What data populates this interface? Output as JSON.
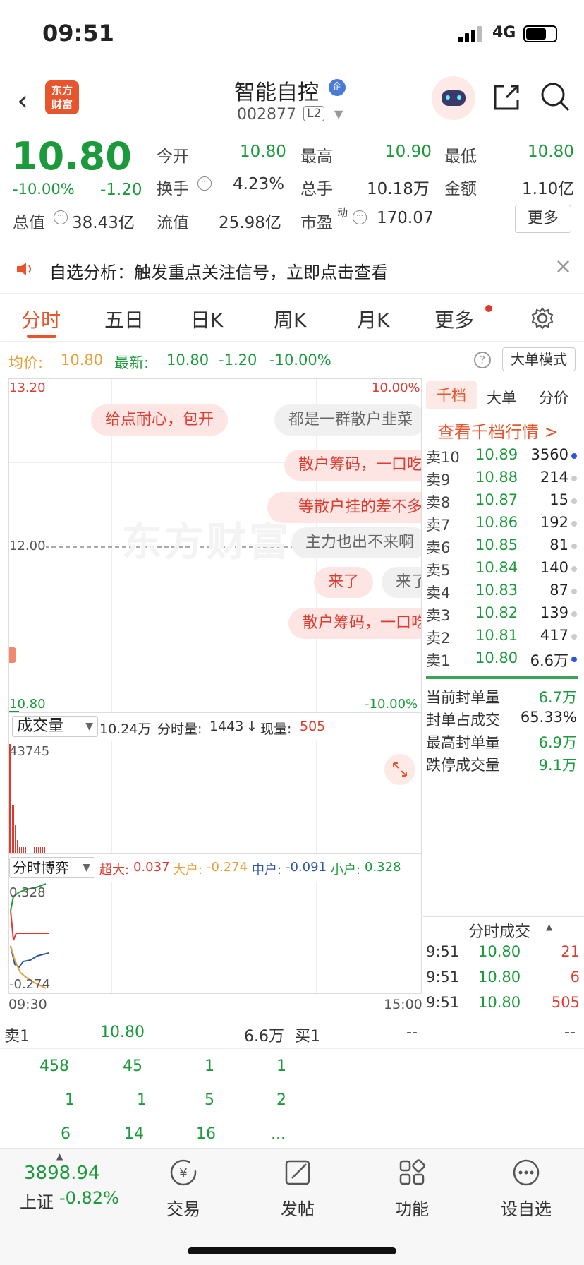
{
  "status": {
    "time": "09:51",
    "network": "4G"
  },
  "header": {
    "logo_text": "东方\n财富",
    "stock_name": "智能自控",
    "badge": "企",
    "code": "002877",
    "level": "L2"
  },
  "quote": {
    "price": "10.80",
    "change_pct": "-10.00%",
    "change": "-1.20",
    "open_label": "今开",
    "open": "10.80",
    "high_label": "最高",
    "high": "10.90",
    "low_label": "最低",
    "low": "10.80",
    "turnover_label": "换手",
    "turnover": "4.23%",
    "volume_label": "总手",
    "volume": "10.18万",
    "amount_label": "金额",
    "amount": "1.10亿",
    "mktcap_label": "总值",
    "mktcap": "38.43亿",
    "float_label": "流值",
    "float": "25.98亿",
    "pe_label": "市盈",
    "pe_sup": "动",
    "pe": "170.07",
    "more_label": "更多"
  },
  "notice": {
    "text": "自选分析：触发重点关注信号，立即点击查看"
  },
  "tabs": [
    "分时",
    "五日",
    "日K",
    "周K",
    "月K",
    "更多"
  ],
  "avg_row": {
    "avg_label": "均价:",
    "avg": "10.80",
    "latest_label": "最新:",
    "latest": "10.80",
    "chg": "-1.20",
    "pct": "-10.00%",
    "mode_label": "大单模式"
  },
  "chart": {
    "y_top": "13.20",
    "pct_top": "10.00%",
    "y_mid": "12.00",
    "y_bottom": "10.80",
    "pct_bottom": "-10.00%",
    "watermark": "东方财富",
    "bubbles": [
      "给点耐心，包开",
      "都是一群散户韭菜",
      "散户筹码，一口吃",
      "等散户挂的差不多",
      "主力也出不来啊",
      "来了",
      "来了",
      "散户筹码，一口吃"
    ]
  },
  "vol": {
    "label": "成交量",
    "total": "10.24万",
    "fs_label": "分时量:",
    "fs": "1443",
    "arrow": "↓",
    "cur_label": "现量:",
    "cur": "505",
    "max": "43745"
  },
  "by": {
    "label": "分时博弈",
    "super_label": "超大:",
    "super": "0.037",
    "big_label": "大户:",
    "big": "-0.274",
    "mid_label": "中户:",
    "mid": "-0.091",
    "small_label": "小户:",
    "small": "0.328",
    "ymax": "0.328",
    "ymin": "-0.274",
    "t_start": "09:30",
    "t_end": "15:00"
  },
  "panel": {
    "tabs": [
      "千档",
      "大单",
      "分价"
    ],
    "link": "查看千档行情 >",
    "asks": [
      {
        "label": "卖10",
        "price": "10.89",
        "vol": "3560"
      },
      {
        "label": "卖9",
        "price": "10.88",
        "vol": "214"
      },
      {
        "label": "卖8",
        "price": "10.87",
        "vol": "15"
      },
      {
        "label": "卖7",
        "price": "10.86",
        "vol": "192"
      },
      {
        "label": "卖6",
        "price": "10.85",
        "vol": "81"
      },
      {
        "label": "卖5",
        "price": "10.84",
        "vol": "140"
      },
      {
        "label": "卖4",
        "price": "10.83",
        "vol": "87"
      },
      {
        "label": "卖3",
        "price": "10.82",
        "vol": "139"
      },
      {
        "label": "卖2",
        "price": "10.81",
        "vol": "417"
      },
      {
        "label": "卖1",
        "price": "10.80",
        "vol": "6.6万"
      }
    ],
    "stats": [
      {
        "label": "当前封单量",
        "value": "6.7万"
      },
      {
        "label": "封单占成交",
        "value": "65.33%"
      },
      {
        "label": "最高封单量",
        "value": "6.9万"
      },
      {
        "label": "跌停成交量",
        "value": "9.1万"
      }
    ],
    "trades_title": "分时成交",
    "trades": [
      {
        "time": "9:51",
        "price": "10.80",
        "vol": "21"
      },
      {
        "time": "9:51",
        "price": "10.80",
        "vol": "6"
      },
      {
        "time": "9:51",
        "price": "10.80",
        "vol": "505"
      }
    ]
  },
  "queue": {
    "sell_label": "卖1",
    "sell_price": "10.80",
    "sell_vol": "6.6万",
    "buy_label": "买1",
    "buy_price": "--",
    "buy_vol": "--",
    "rows": [
      [
        "458",
        "45",
        "1",
        "1"
      ],
      [
        "1",
        "1",
        "5",
        "2"
      ],
      [
        "6",
        "14",
        "16",
        "..."
      ]
    ]
  },
  "bottom": {
    "index": "3898.94",
    "index_name": "上证",
    "index_pct": "-0.82%",
    "nav": [
      {
        "label": "交易",
        "icon": "trade-icon"
      },
      {
        "label": "发帖",
        "icon": "post-icon"
      },
      {
        "label": "功能",
        "icon": "function-icon"
      },
      {
        "label": "设自选",
        "icon": "more-icon"
      }
    ]
  }
}
